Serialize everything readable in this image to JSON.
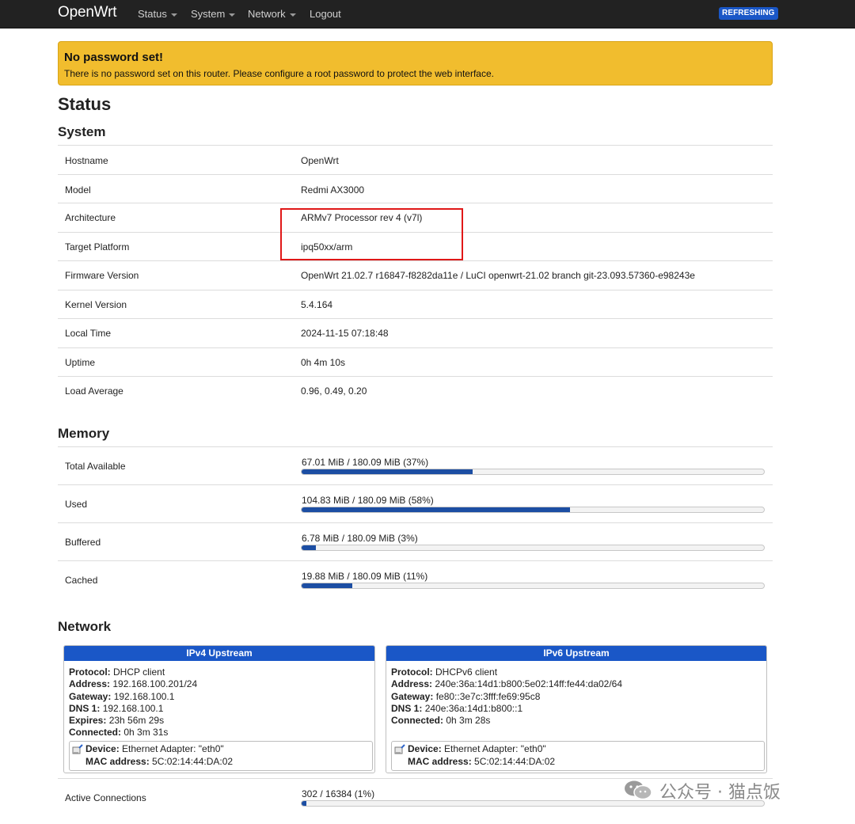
{
  "navbar": {
    "brand": "OpenWrt",
    "menus": [
      {
        "label": "Status",
        "has_caret": true
      },
      {
        "label": "System",
        "has_caret": true
      },
      {
        "label": "Network",
        "has_caret": true
      },
      {
        "label": "Logout",
        "has_caret": false
      }
    ],
    "status_badge": "REFRESHING",
    "accent_color": "#1a57c7"
  },
  "alert": {
    "title": "No password set!",
    "text": "There is no password set on this router. Please configure a root password to protect the web interface.",
    "color": "#f1bd2e"
  },
  "page_title": "Status",
  "system": {
    "heading": "System",
    "rows": [
      {
        "key": "Hostname",
        "value": "OpenWrt"
      },
      {
        "key": "Model",
        "value": "Redmi AX3000"
      },
      {
        "key": "Architecture",
        "value": "ARMv7 Processor rev 4 (v7l)"
      },
      {
        "key": "Target Platform",
        "value": "ipq50xx/arm"
      },
      {
        "key": "Firmware Version",
        "value": "OpenWrt 21.02.7 r16847-f8282da11e / LuCI openwrt-21.02 branch git-23.093.57360-e98243e"
      },
      {
        "key": "Kernel Version",
        "value": "5.4.164"
      },
      {
        "key": "Local Time",
        "value": "2024-11-15 07:18:48"
      },
      {
        "key": "Uptime",
        "value": "0h 4m 10s"
      },
      {
        "key": "Load Average",
        "value": "0.96, 0.49, 0.20"
      }
    ]
  },
  "memory": {
    "heading": "Memory",
    "rows": [
      {
        "key": "Total Available",
        "value": "67.01 MiB / 180.09 MiB (37%)",
        "percent": 37
      },
      {
        "key": "Used",
        "value": "104.83 MiB / 180.09 MiB (58%)",
        "percent": 58
      },
      {
        "key": "Buffered",
        "value": "6.78 MiB / 180.09 MiB (3%)",
        "percent": 3
      },
      {
        "key": "Cached",
        "value": "19.88 MiB / 180.09 MiB (11%)",
        "percent": 11
      }
    ]
  },
  "network": {
    "heading": "Network",
    "ipv4": {
      "title": "IPv4 Upstream",
      "lines": [
        {
          "label": "Protocol:",
          "value": "DHCP client"
        },
        {
          "label": "Address:",
          "value": "192.168.100.201/24"
        },
        {
          "label": "Gateway:",
          "value": "192.168.100.1"
        },
        {
          "label": "DNS 1:",
          "value": "192.168.100.1"
        },
        {
          "label": "Expires:",
          "value": "23h 56m 29s"
        },
        {
          "label": "Connected:",
          "value": "0h 3m 31s"
        }
      ],
      "device_label": "Device:",
      "device_value": "Ethernet Adapter: \"eth0\"",
      "mac_label": "MAC address:",
      "mac_value": "5C:02:14:44:DA:02"
    },
    "ipv6": {
      "title": "IPv6 Upstream",
      "lines": [
        {
          "label": "Protocol:",
          "value": "DHCPv6 client"
        },
        {
          "label": "Address:",
          "value": "240e:36a:14d1:b800:5e02:14ff:fe44:da02/64"
        },
        {
          "label": "Gateway:",
          "value": "fe80::3e7c:3fff:fe69:95c8"
        },
        {
          "label": "DNS 1:",
          "value": "240e:36a:14d1:b800::1"
        },
        {
          "label": "Connected:",
          "value": "0h 3m 28s"
        }
      ],
      "device_label": "Device:",
      "device_value": "Ethernet Adapter: \"eth0\"",
      "mac_label": "MAC address:",
      "mac_value": "5C:02:14:44:DA:02"
    },
    "active_connections": {
      "key": "Active Connections",
      "value": "302 / 16384 (1%)",
      "percent": 1
    }
  },
  "watermark": {
    "text": "公众号 · 猫点饭",
    "icon": "wechat-icon"
  },
  "highlight_color": "#e01818"
}
